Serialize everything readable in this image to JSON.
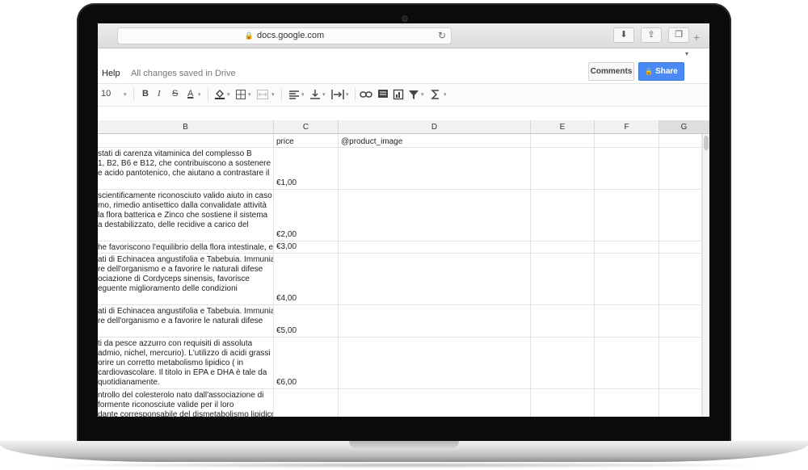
{
  "browser": {
    "url": "docs.google.com",
    "lock_icon": "🔒",
    "reload_icon": "↻",
    "download_icon": "⬇",
    "share_icon": "⇪",
    "tabs_icon": "❐",
    "new_tab_icon": "+"
  },
  "docs": {
    "menu_help": "Help",
    "save_status": "All changes saved in Drive",
    "comments_label": "Comments",
    "share_label": "Share",
    "share_lock_icon": "🔒",
    "share_color": "#4a8af4"
  },
  "toolbar": {
    "font_size": "10",
    "bold": "B",
    "italic": "I",
    "strike": "S",
    "text_color": "A",
    "caret": "▾"
  },
  "sheet": {
    "columns": [
      "B",
      "C",
      "D",
      "E",
      "F",
      "G"
    ],
    "selected_column": "G",
    "header_row": {
      "c": "price",
      "d": "@product_image"
    },
    "rows": [
      {
        "b": [
          "stati di carenza vitaminica del complesso B",
          "1, B2, B6 e B12, che contribuiscono a sostenere i",
          "e acido pantotenico, che aiutano a contrastare il"
        ],
        "c": "€1,00"
      },
      {
        "b": [
          "scientificamente riconosciuto  valido aiuto in caso",
          "mo, rimedio antisettico dalla convalidate attività",
          "la flora batterica e Zinco che sostiene il sistema",
          "a destabilizzato, delle recidive a carico del"
        ],
        "c": "€2,00"
      },
      {
        "b": [
          "he favoriscono l'equilibrio della flora intestinale, e v"
        ],
        "c": "€3,00"
      },
      {
        "b": [
          "ati di Echinacea angustifolia e Tabebuia. Immunia",
          "re dell'organismo e a favorire le naturali difese",
          "ociazione di Cordyceps sinensis, favorisce",
          "eguente miglioramento delle condizioni"
        ],
        "c": "€4,00"
      },
      {
        "b": [
          "ati di Echinacea angustifolia e Tabebuia. Immunia",
          "re dell'organismo e a favorire le naturali difese"
        ],
        "c": "€5,00"
      },
      {
        "b": [
          "ti da pesce azzurro con requisiti di assoluta",
          "admio, nichel, mercurio). L'utilizzo di acidi grassi",
          "orire un corretto metabolismo lipidico ( in",
          "cardiovascolare. Il titolo in EPA e DHA è tale da",
          "quotidianamente."
        ],
        "c": "€6,00"
      },
      {
        "b": [
          "ntrollo del colesterolo nato dall'associazione di",
          "formente riconosciute valide per il loro",
          "dante corresponsabile del dismetabolismo lipidico"
        ],
        "c": ""
      }
    ]
  }
}
